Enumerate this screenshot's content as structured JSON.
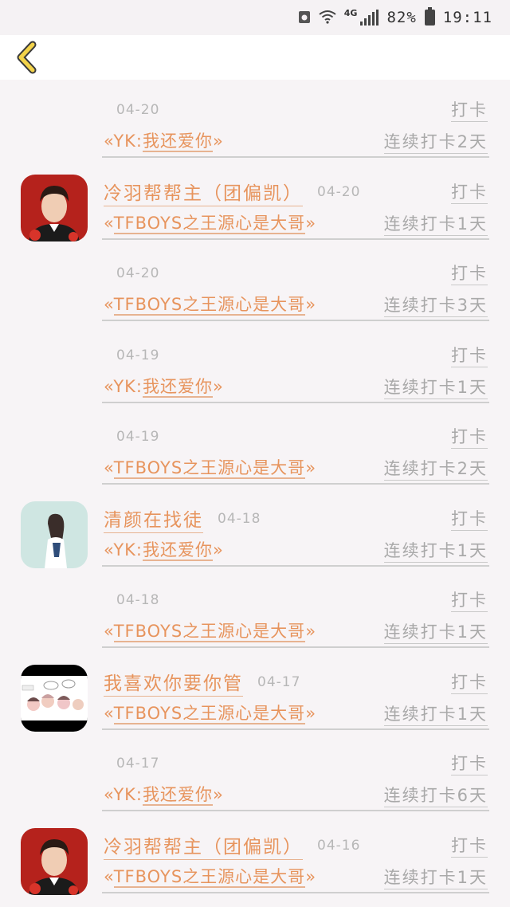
{
  "status_bar": {
    "network": "4G",
    "battery": "82%",
    "time": "19:11"
  },
  "header": {
    "back_icon": "chevron-left-icon",
    "back_color": "#f3d34a"
  },
  "colors": {
    "accent": "#e7945d",
    "muted": "#a9a9a9",
    "background": "#f7f4f6"
  },
  "checkin_label": "打卡",
  "items": [
    {
      "name": "",
      "date": "04-20",
      "group_open": "«YK:",
      "group_name": "我还爱你",
      "group_close": "»",
      "streak": "连续打卡2天"
    },
    {
      "name": "冷羽帮帮主（团偏凯）",
      "date": "04-20",
      "group_open": "«",
      "group_name": "TFBOYS之王源心是大哥",
      "group_close": "»",
      "streak": "连续打卡1天",
      "avatar": "boy"
    },
    {
      "name": "",
      "date": "04-20",
      "group_open": "«",
      "group_name": "TFBOYS之王源心是大哥",
      "group_close": "»",
      "streak": "连续打卡3天"
    },
    {
      "name": "",
      "date": "04-19",
      "group_open": "«YK:",
      "group_name": "我还爱你",
      "group_close": "»",
      "streak": "连续打卡1天"
    },
    {
      "name": "",
      "date": "04-19",
      "group_open": "«",
      "group_name": "TFBOYS之王源心是大哥",
      "group_close": "»",
      "streak": "连续打卡2天"
    },
    {
      "name": "清颜在找徒",
      "date": "04-18",
      "group_open": "«YK:",
      "group_name": "我还爱你",
      "group_close": "»",
      "streak": "连续打卡1天",
      "avatar": "girl"
    },
    {
      "name": "",
      "date": "04-18",
      "group_open": "«",
      "group_name": "TFBOYS之王源心是大哥",
      "group_close": "»",
      "streak": "连续打卡1天"
    },
    {
      "name": "我喜欢你要你管",
      "date": "04-17",
      "group_open": "«",
      "group_name": "TFBOYS之王源心是大哥",
      "group_close": "»",
      "streak": "连续打卡1天",
      "avatar": "cartoon"
    },
    {
      "name": "",
      "date": "04-17",
      "group_open": "«YK:",
      "group_name": "我还爱你",
      "group_close": "»",
      "streak": "连续打卡6天"
    },
    {
      "name": "冷羽帮帮主（团偏凯）",
      "date": "04-16",
      "group_open": "«",
      "group_name": "TFBOYS之王源心是大哥",
      "group_close": "»",
      "streak": "连续打卡1天",
      "avatar": "boy"
    }
  ]
}
